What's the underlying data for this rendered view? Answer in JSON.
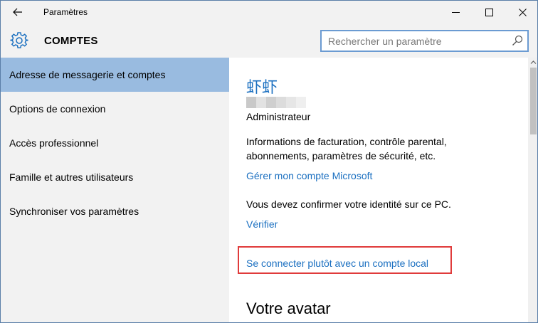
{
  "window": {
    "title": "Paramètres"
  },
  "header": {
    "section": "COMPTES",
    "search_placeholder": "Rechercher un paramètre"
  },
  "sidebar": {
    "items": [
      {
        "label": "Adresse de messagerie et comptes",
        "selected": true
      },
      {
        "label": "Options de connexion",
        "selected": false
      },
      {
        "label": "Accès professionnel",
        "selected": false
      },
      {
        "label": "Famille et autres utilisateurs",
        "selected": false
      },
      {
        "label": "Synchroniser vos paramètres",
        "selected": false
      }
    ]
  },
  "account": {
    "username": "虾虾",
    "role": "Administrateur",
    "billing_info": "Informations de facturation, contrôle parental, abonnements, paramètres de sécurité, etc.",
    "manage_link": "Gérer mon compte Microsoft",
    "confirm_text": "Vous devez confirmer votre identité sur ce PC.",
    "verify_link": "Vérifier",
    "local_account_link": "Se connecter plutôt avec un compte local",
    "avatar_heading": "Votre avatar"
  },
  "colors": {
    "accent": "#1a6fc0",
    "selected_nav": "#99bbe0",
    "highlight_box": "#e03b3b",
    "chrome_bg": "#f2f2f2"
  }
}
